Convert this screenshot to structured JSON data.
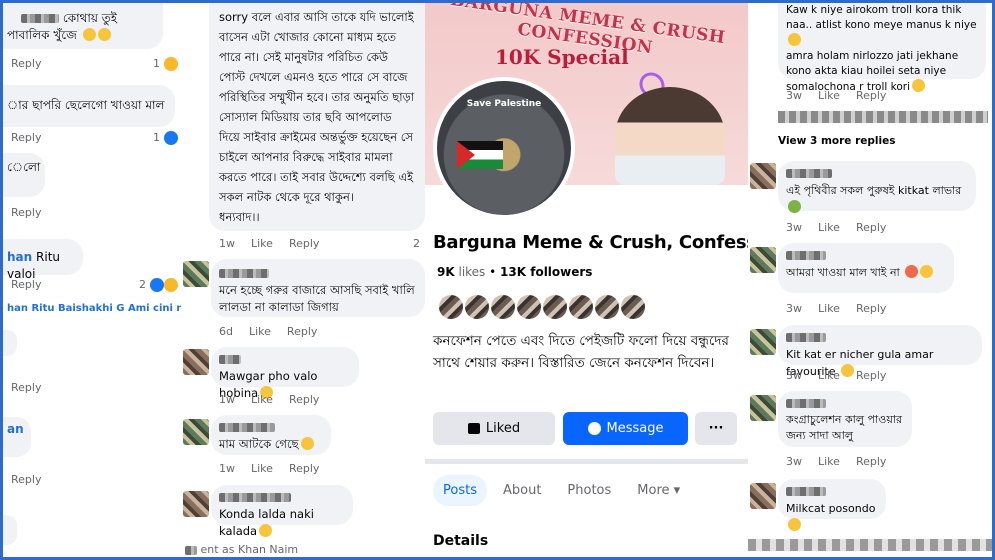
{
  "col1": {
    "c1_text": "কোথায় তুই পাবালিক খুঁজে",
    "c1_reply": "Reply",
    "c1_count": "1",
    "c2_text": "ার ছাপরি ছেলেগো খাওয়া মাল",
    "c2_reply": "Reply",
    "c2_count": "1",
    "c3_text": "েলো",
    "c3_reply": "Reply",
    "c4_name": "han",
    "c4_text": "Ritu valoi",
    "c4_reply": "Reply",
    "c4_count": "2",
    "c5_text": "han Ritu Baishakhi G Ami cini na vai,...",
    "c6_reply": "Reply",
    "c7_name": "an",
    "c7_reply": "Reply"
  },
  "col2": {
    "post_text": "sorry বলে এবার আসি তাকে যদি ভালোই বাসেন এটা খোজার কোনো মাধ্যম হতে পারে না। সেই মানুষটার পরিচিত কেউ পোস্ট দেখলে এমনও হতে পারে সে বাজে পরিস্থিতির সম্মুখীন হবে। তার অনুমতি ছাড়া সোস্যাল মিডিয়ায় তার ছবি আপলোড দিয়ে সাইবার ক্রাইমের অন্তর্ভুক্ত হয়েছেন সে চাইলে আপনার বিরুদ্ধে সাইবার মামলা করতে পারে। তাই সবার উদ্দেশ্যে বলছি এই সকল নাটক থেকে দূরে থাকুন।",
    "post_sign": "ধন্যবাদ।।",
    "post_meta": {
      "time": "1w",
      "like": "Like",
      "reply": "Reply",
      "count": "2"
    },
    "c1_text": "মনে হচ্ছে গরুর বাজারে আসছি সবাই খালি লালডা না কালাডা জিগায়",
    "c1_meta": {
      "time": "6d",
      "like": "Like",
      "reply": "Reply"
    },
    "c2_text": "Mawgar pho valo hobina",
    "c2_meta": {
      "time": "1w",
      "like": "Like",
      "reply": "Reply"
    },
    "c3_text": "মাম আটকে গেছে",
    "c3_meta": {
      "time": "1w",
      "like": "Like",
      "reply": "Reply"
    },
    "c4_text": "Konda lalda naki kalada",
    "comment_as": "ent as Khan Naim"
  },
  "page": {
    "cover_title": "BARGUNA MEME & CRUSH CONFESSION",
    "cover_sub": "10K Special",
    "pp_label": "Save Palestine",
    "name": "Barguna Meme & Crush, Confession",
    "likes": "9K",
    "likes_label": "likes",
    "dot": "•",
    "followers": "13K followers",
    "bio": "কনফেশন পেতে এবং দিতে পেইজটি ফলো দিয়ে বন্ধুদের সাথে শেয়ার করুন। বিস্তারিত জেনে কনফেশন দিবেন।",
    "liked_label": "Liked",
    "message_label": "Message",
    "more_label": "···",
    "tabs": [
      "Posts",
      "About",
      "Photos",
      "More"
    ],
    "details_label": "Details"
  },
  "col4": {
    "c1_text": "Kaw k niye airokom troll kora thik naa.. atlist kono meye manus k niye",
    "c1_text2": "amra holam nirlozzo jati jekhane kono akta kiau hoilei seta niye somalochona r troll kori",
    "c1_meta": {
      "time": "3w",
      "like": "Like",
      "reply": "Reply"
    },
    "more_replies": "View 3 more replies",
    "c2_text": "এই পৃথিবীর সকল পুরুষই kitkat লাভার",
    "c2_meta": {
      "time": "3w",
      "like": "Like",
      "reply": "Reply"
    },
    "c3_text": "আমরা খাওয়া মাল খাই না",
    "c3_meta": {
      "time": "3w",
      "like": "Like",
      "reply": "Reply"
    },
    "c4_text": "Kit kat er nicher gula amar favourite",
    "c4_meta": {
      "time": "3w",
      "like": "Like",
      "reply": "Reply"
    },
    "c5_text": "কংগ্রাচুলেশন কালু পাওয়ার জন্য সাদা আলু",
    "c5_meta": {
      "time": "3w",
      "like": "Like",
      "reply": "Reply"
    },
    "c6_text": "Milkcat posondo"
  }
}
